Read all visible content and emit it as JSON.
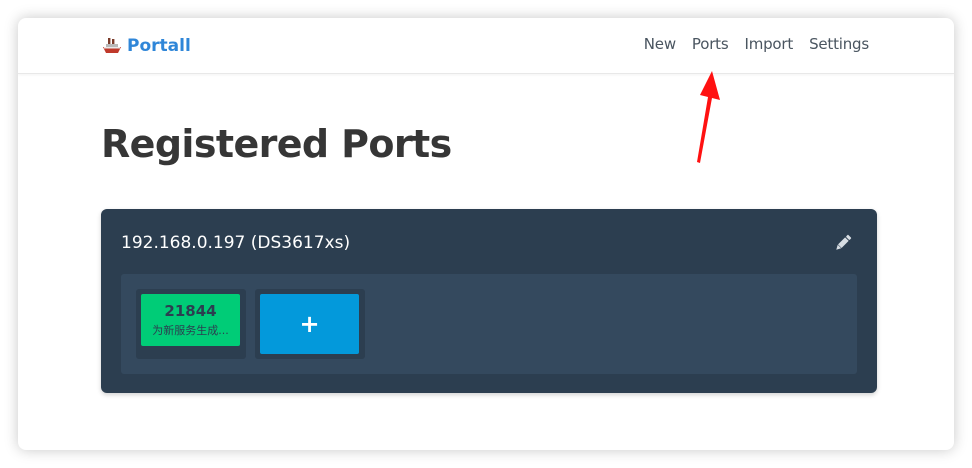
{
  "app": {
    "name": "Portall"
  },
  "nav": {
    "items": [
      {
        "label": "New"
      },
      {
        "label": "Ports"
      },
      {
        "label": "Import"
      },
      {
        "label": "Settings"
      }
    ]
  },
  "page": {
    "title": "Registered Ports"
  },
  "host": {
    "name": "192.168.0.197 (DS3617xs)",
    "ports": [
      {
        "number": "21844",
        "description": "为新服务生成..."
      }
    ],
    "add_label": "+"
  },
  "icons": {
    "brand": "ship-icon",
    "edit": "pencil-icon",
    "annotation": "red-arrow-icon"
  },
  "colors": {
    "brand": "#2f86d8",
    "card": "#2c3e50",
    "ports_area": "#34495e",
    "port_tile": "#00cc77",
    "add_tile": "#0399db",
    "annotation_arrow": "#ff1111"
  }
}
